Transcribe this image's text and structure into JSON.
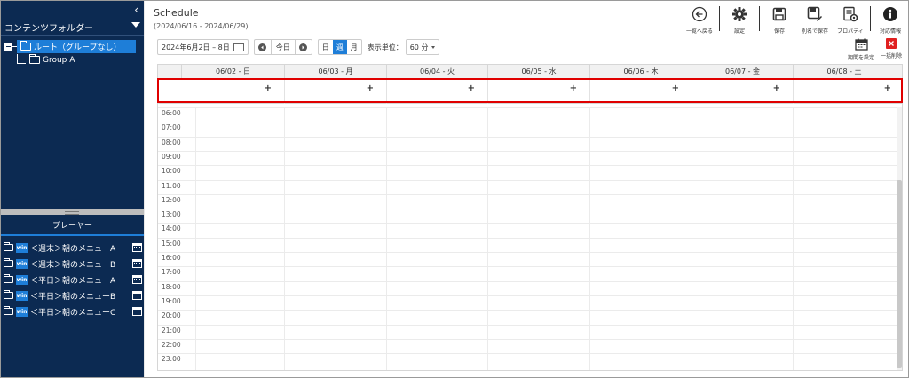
{
  "sidebar": {
    "collapse_glyph": "‹",
    "folder_header": "コンテンツフォルダー",
    "tree": {
      "root_label": "ルート（グループなし）",
      "child_label": "Group A"
    },
    "player_header": "プレーヤー",
    "players": [
      {
        "badge": "win",
        "name": "＜週末＞朝のメニューA"
      },
      {
        "badge": "win",
        "name": "＜週末＞朝のメニューB"
      },
      {
        "badge": "win",
        "name": "＜平日＞朝のメニューA"
      },
      {
        "badge": "win",
        "name": "＜平日＞朝のメニューB"
      },
      {
        "badge": "win",
        "name": "＜平日＞朝のメニューC"
      }
    ]
  },
  "header": {
    "title": "Schedule",
    "subtitle": "(2024/06/16 - 2024/06/29)"
  },
  "toolbar": {
    "back_label": "一覧へ戻る",
    "settings_label": "設定",
    "save_label": "保存",
    "save_as_label": "別名で保存",
    "properties_label": "プロパティ",
    "info_label": "対応情報"
  },
  "controls": {
    "date_range": "2024年6月2日 – 8日",
    "today_label": "今日",
    "view_day": "日",
    "view_week": "週",
    "view_month": "月",
    "unit_label": "表示単位：",
    "unit_value": "60 分"
  },
  "actions": {
    "set_period_label": "期間を設定",
    "delete_all_label": "一括削除"
  },
  "calendar": {
    "days": [
      "06/02 - 日",
      "06/03 - 月",
      "06/04 - 火",
      "06/05 - 水",
      "06/06 - 木",
      "06/07 - 金",
      "06/08 - 土"
    ],
    "plus": "+",
    "times": [
      "06:00",
      "07:00",
      "08:00",
      "09:00",
      "10:00",
      "11:00",
      "12:00",
      "13:00",
      "14:00",
      "15:00",
      "16:00",
      "17:00",
      "18:00",
      "19:00",
      "20:00",
      "21:00",
      "22:00",
      "23:00"
    ]
  },
  "colors": {
    "sidebar_bg": "#0c2a52",
    "accent": "#1e7ed8",
    "highlight": "#e00000"
  }
}
